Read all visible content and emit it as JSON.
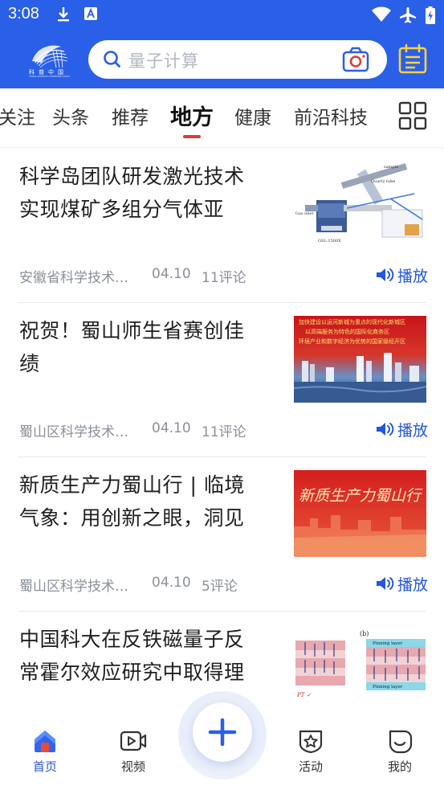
{
  "status_bar": {
    "time": "3:08"
  },
  "header": {
    "search_placeholder": "量子计算"
  },
  "tabs": [
    {
      "label": "关注"
    },
    {
      "label": "头条"
    },
    {
      "label": "推荐"
    },
    {
      "label": "地方",
      "active": true
    },
    {
      "label": "健康"
    },
    {
      "label": "前沿科技"
    }
  ],
  "feed": [
    {
      "title": "科学岛团队研发激光技术实现煤矿多组分气体亚",
      "title_line1": "科学岛团队研发激光技术",
      "title_line2": "实现煤矿多组分气体亚",
      "source": "安徽省科学技术…",
      "date": "04.10",
      "comments": "11评论",
      "play_label": "播放",
      "thumb_icon": "lab-equipment-diagram",
      "thumb_labels": {
        "a": "Quartz tube",
        "b": "GSL-1500X",
        "c": "Gas inlet",
        "d": "sample"
      }
    },
    {
      "title": "祝贺！蜀山师生省赛创佳绩",
      "title_line1": "祝贺！蜀山师生省赛创佳",
      "title_line2": "绩",
      "source": "蜀山区科学技术…",
      "date": "04.10",
      "comments": "11评论",
      "play_label": "播放",
      "thumb_icon": "city-skyline-banner",
      "thumb_banner_1": "加快建设以运河新城为重点的现代化新城区",
      "thumb_banner_2": "以高端服务为特色的国际化商务区",
      "thumb_banner_3": "环境产业和数字经济为优势的国家级经开区"
    },
    {
      "title": "新质生产力蜀山行 | 临境气象：用创新之眼，洞见",
      "title_line1": "新质生产力蜀山行 | 临境",
      "title_line2": "气象：用创新之眼，洞见",
      "source": "蜀山区科学技术…",
      "date": "04.10",
      "comments": "5评论",
      "play_label": "播放",
      "thumb_icon": "red-banner",
      "thumb_text": "新质生产力蜀山行"
    },
    {
      "title": "中国科大在反铁磁量子反常霍尔效应研究中取得理",
      "title_line1": "中国科大在反铁磁量子反",
      "title_line2": "常霍尔效应研究中取得理",
      "thumb_icon": "layer-diagram",
      "thumb_labels": {
        "b": "(b)",
        "pin1": "Pinning layer",
        "pin2": "Pinning layer",
        "pt": "PT ✓"
      }
    }
  ],
  "bottom_nav": [
    {
      "label": "首页",
      "icon": "home-icon",
      "active": true
    },
    {
      "label": "视频",
      "icon": "video-icon"
    },
    {
      "label": "活动",
      "icon": "activity-badge-icon"
    },
    {
      "label": "我的",
      "icon": "profile-icon"
    }
  ],
  "colors": {
    "brand": "#2a5fe8",
    "accent_red": "#e03a3a",
    "play_blue": "#2456e0"
  }
}
